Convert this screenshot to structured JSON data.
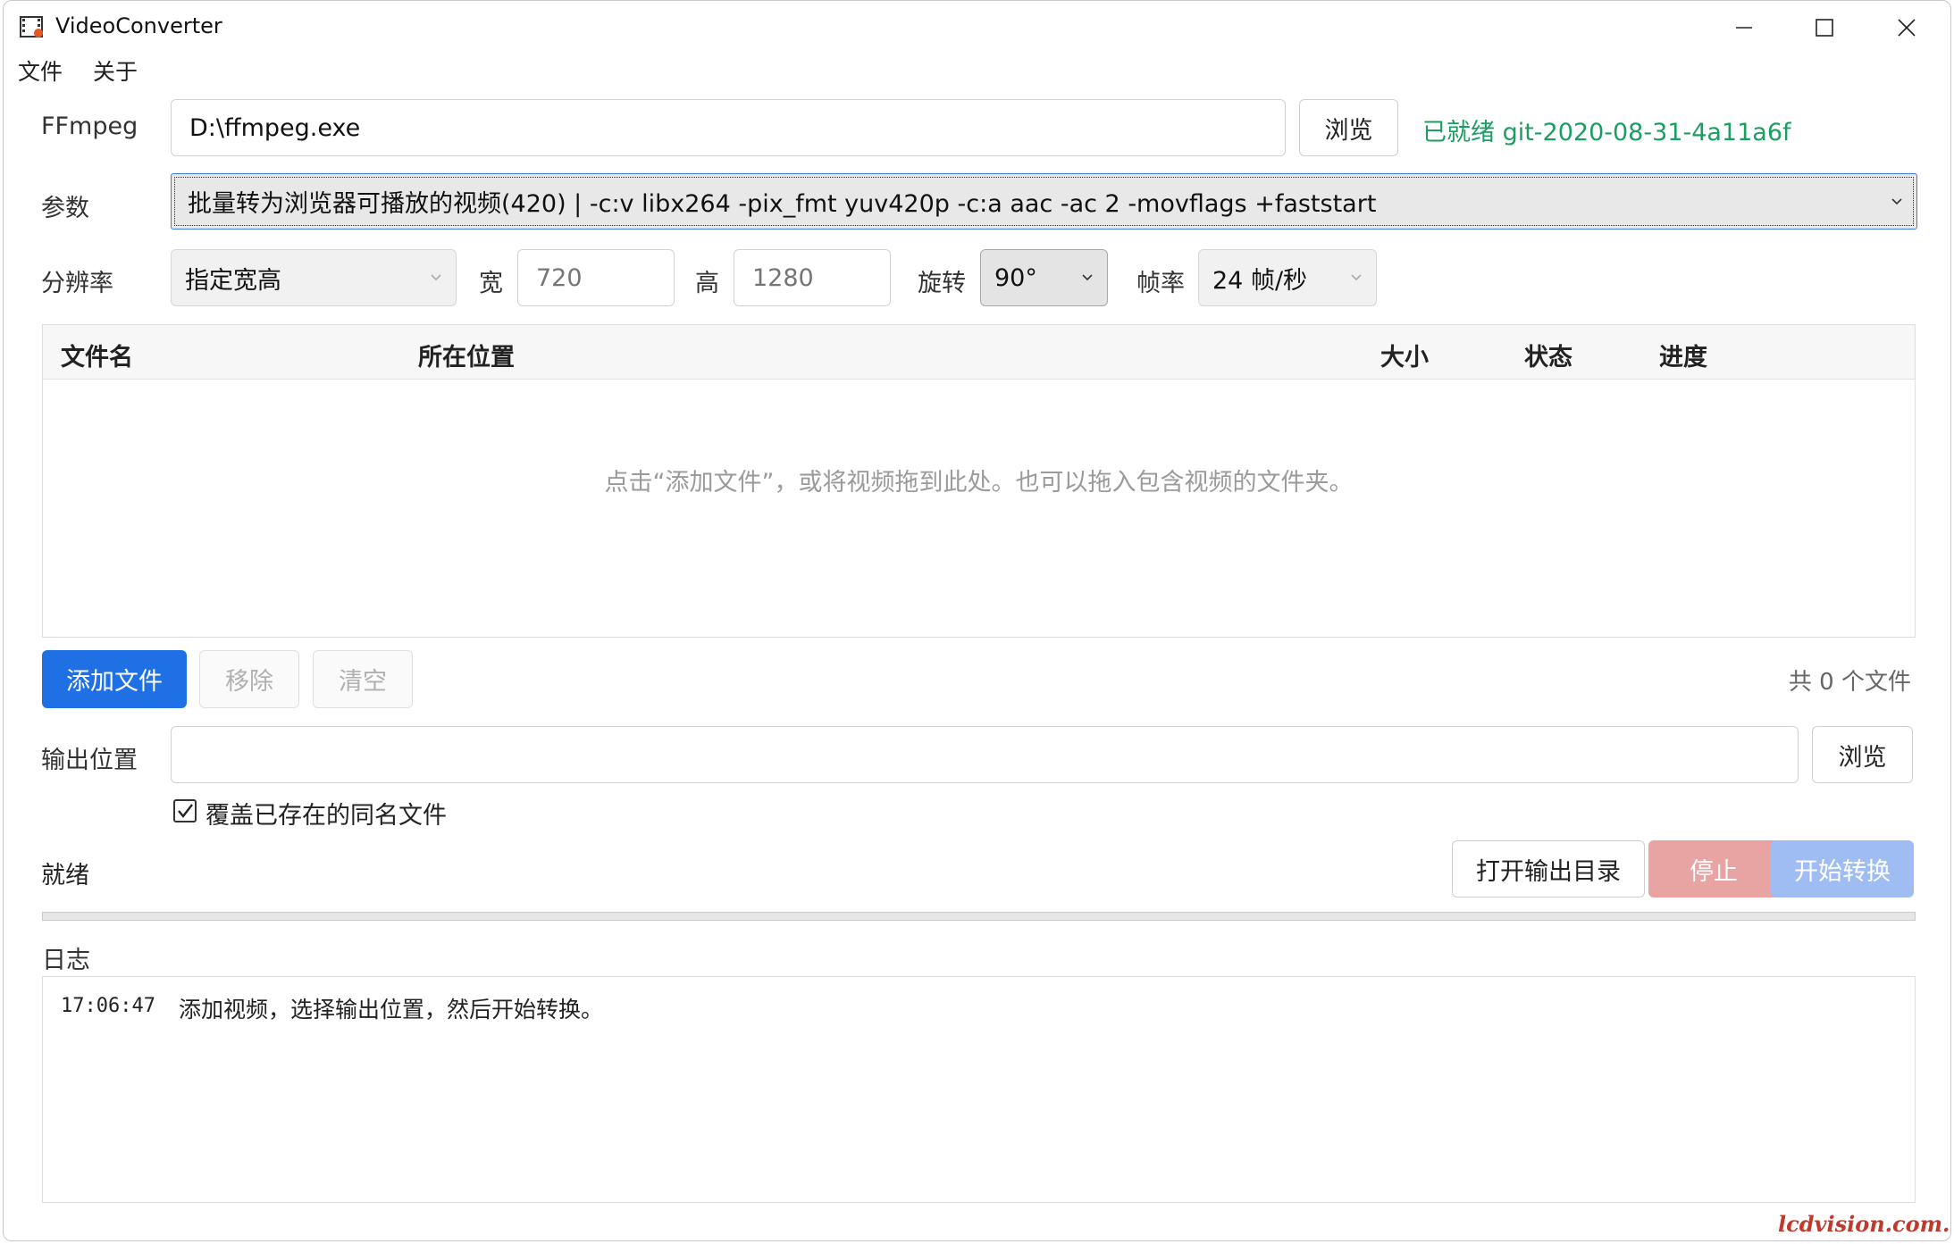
{
  "window": {
    "title": "VideoConverter"
  },
  "menu": [
    "文件",
    "关于"
  ],
  "ffmpeg": {
    "label": "FFmpeg",
    "path": "D:\\ffmpeg.exe",
    "browse_label": "浏览",
    "status": "已就绪 git-2020-08-31-4a11a6f",
    "status_color": "#1a9e62"
  },
  "params": {
    "label": "参数",
    "selected": "批量转为浏览器可播放的视频(420) | -c:v libx264 -pix_fmt yuv420p -c:a aac -ac 2 -movflags +faststart"
  },
  "resolution": {
    "label": "分辨率",
    "mode": "指定宽高",
    "width_label": "宽",
    "width_placeholder": "720",
    "height_label": "高",
    "height_placeholder": "1280",
    "rotate_label": "旋转",
    "rotate_value": "90°",
    "fps_label": "帧率",
    "fps_value": "24 帧/秒"
  },
  "file_table": {
    "columns": [
      "文件名",
      "所在位置",
      "大小",
      "状态",
      "进度"
    ],
    "rows": [],
    "empty_hint": "点击“添加文件”，或将视频拖到此处。也可以拖入包含视频的文件夹。"
  },
  "file_actions": {
    "add_label": "添加文件",
    "remove_label": "移除",
    "clear_label": "清空",
    "count_text": "共 0 个文件"
  },
  "output": {
    "label": "输出位置",
    "path": "",
    "browse_label": "浏览",
    "overwrite_label": "覆盖已存在的同名文件",
    "overwrite_checked": true
  },
  "status": {
    "text": "就绪",
    "open_dir_label": "打开输出目录",
    "stop_label": "停止",
    "start_label": "开始转换",
    "progress": 0
  },
  "log": {
    "label": "日志",
    "entries": [
      {
        "time": "17:06:47",
        "message": "添加视频，选择输出位置，然后开始转换。"
      }
    ]
  },
  "watermark": "lcdvision.com.cn",
  "colors": {
    "accent": "#1f6fe5",
    "stop": "#e8a3a3",
    "start_disabled": "#9fbdf2"
  }
}
